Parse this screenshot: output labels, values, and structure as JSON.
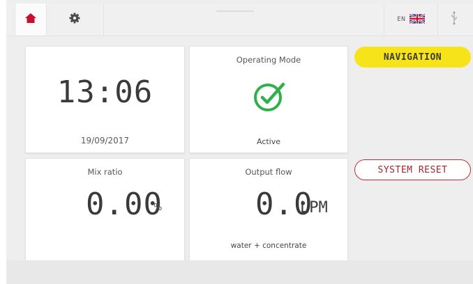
{
  "topbar": {
    "home_icon": "home-icon",
    "settings_icon": "gear-icon",
    "language_code": "EN",
    "language_flag": "uk-flag-icon",
    "usb_icon": "usb-icon"
  },
  "clock": {
    "time": "13:06",
    "date": "19/09/2017"
  },
  "operating_mode": {
    "title": "Operating Mode",
    "icon": "check-circle-icon",
    "status": "Active"
  },
  "mix_ratio": {
    "title": "Mix ratio",
    "value": "0.00",
    "unit": "%"
  },
  "output_flow": {
    "title": "Output flow",
    "value": "0.0",
    "unit": "LPM",
    "subtitle": "water + concentrate"
  },
  "buttons": {
    "navigation_label": "NAVIGATION",
    "system_reset_label": "SYSTEM RESET"
  },
  "colors": {
    "accent_red": "#c8102e",
    "success_green": "#2fb04a",
    "navigation_yellow": "#f6e31a",
    "reset_border": "#b43038"
  }
}
